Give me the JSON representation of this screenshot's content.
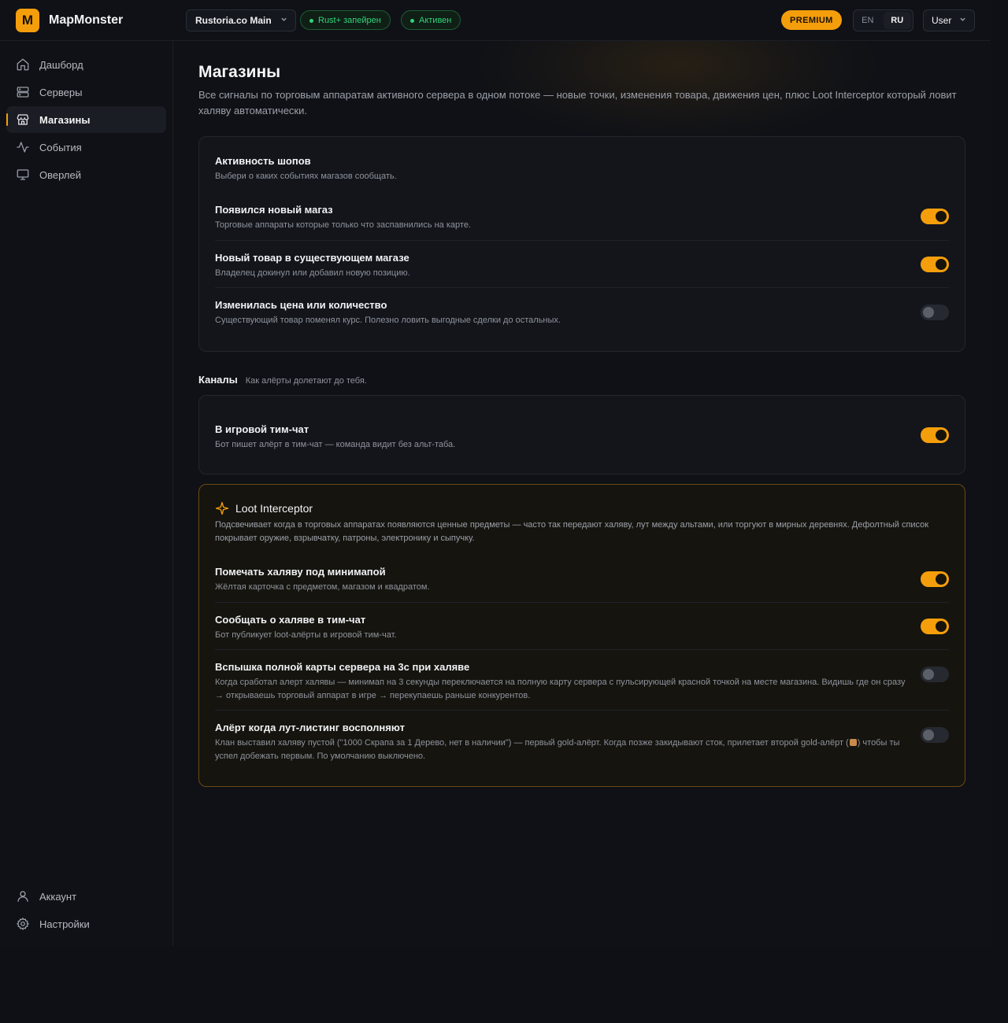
{
  "header": {
    "logo_letter": "M",
    "brand": "MapMonster",
    "server": "Rustoria.co Main",
    "pill_paired": "Rust+ запейрен",
    "pill_active": "Активен",
    "premium": "PREMIUM",
    "lang_en": "EN",
    "lang_ru": "RU",
    "user": "User"
  },
  "sidebar": {
    "items": [
      {
        "label": "Дашборд",
        "icon": "home-icon"
      },
      {
        "label": "Серверы",
        "icon": "server-icon"
      },
      {
        "label": "Магазины",
        "icon": "store-icon",
        "active": true
      },
      {
        "label": "События",
        "icon": "activity-icon"
      },
      {
        "label": "Оверлей",
        "icon": "monitor-icon"
      }
    ],
    "bottom": [
      {
        "label": "Аккаунт",
        "icon": "user-icon"
      },
      {
        "label": "Настройки",
        "icon": "gear-icon"
      }
    ]
  },
  "main": {
    "title": "Магазины",
    "description": "Все сигналы по торговым аппаратам активного сервера в одном потоке — новые точки, изменения товара, движения цен, плюс Loot Interceptor который ловит халяву автоматически.",
    "activity": {
      "title": "Активность шопов",
      "subtitle": "Выбери о каких событиях магазов сообщать.",
      "rows": [
        {
          "title": "Появился новый магаз",
          "desc": "Торговые аппараты которые только что заспавнились на карте.",
          "on": true
        },
        {
          "title": "Новый товар в существующем магазе",
          "desc": "Владелец докинул или добавил новую позицию.",
          "on": true
        },
        {
          "title": "Изменилась цена или количество",
          "desc": "Существующий товар поменял курс. Полезно ловить выгодные сделки до остальных.",
          "on": false
        }
      ]
    },
    "channels": {
      "title": "Каналы",
      "subtitle": "Как алёрты долетают до тебя.",
      "rows": [
        {
          "title": "В игровой тим-чат",
          "desc": "Бот пишет алёрт в тим-чат — команда видит без альт-таба.",
          "on": true
        }
      ]
    },
    "loot": {
      "title": "Loot Interceptor",
      "desc": "Подсвечивает когда в торговых аппаратах появляются ценные предметы — часто так передают халяву, лут между альтами, или торгуют в мирных деревнях. Дефолтный список покрывает оружие, взрывчатку, патроны, электронику и сыпучку.",
      "rows": [
        {
          "title": "Помечать халяву под минимапой",
          "desc": "Жёлтая карточка с предметом, магазом и квадратом.",
          "on": true
        },
        {
          "title": "Сообщать о халяве в тим-чат",
          "desc": "Бот публикует loot-алёрты в игровой тим-чат.",
          "on": true
        },
        {
          "title": "Вспышка полной карты сервера на 3с при халяве",
          "desc": "Когда сработал алерт халявы — минимап на 3 секунды переключается на полную карту сервера с пульсирующей красной точкой на месте магазина. Видишь где он сразу → открываешь торговый аппарат в игре → перекупаешь раньше конкурентов.",
          "on": false
        },
        {
          "title": "Алёрт когда лут-листинг восполняют",
          "desc_a": "Клан выставил халяву пустой (\"1000 Скрапа за 1 Дерево, нет в наличии\") — первый gold-алёрт. Когда позже закидывают сток, прилетает второй gold-алёрт (",
          "desc_b": ") чтобы ты успел добежать первым. По умолчанию выключено.",
          "on": false
        }
      ]
    }
  },
  "colors": {
    "accent": "#f59e0b",
    "bg": "#0f1116",
    "card": "#13151b",
    "success": "#34d27a"
  }
}
